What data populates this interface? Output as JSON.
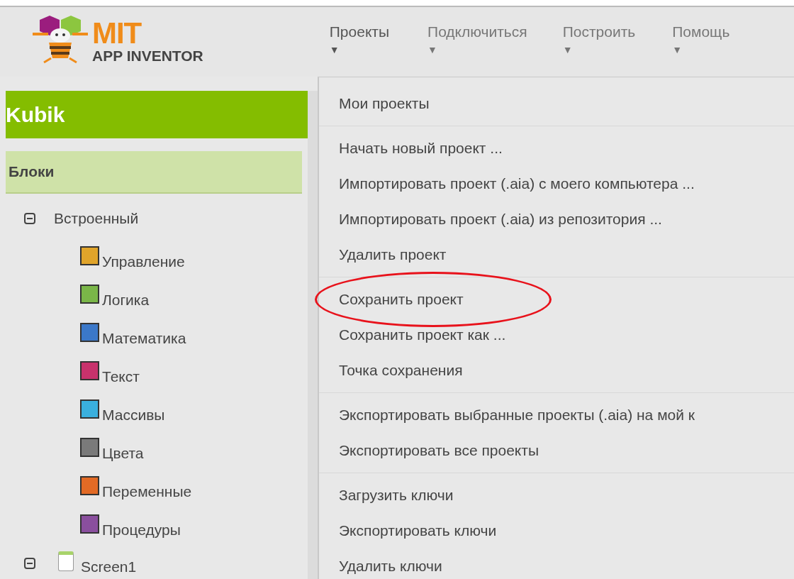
{
  "logo": {
    "title": "MIT",
    "subtitle": "APP INVENTOR"
  },
  "nav": [
    {
      "label": "Проекты",
      "arrow": "▼",
      "selected": true
    },
    {
      "label": "Подключиться",
      "arrow": "▼",
      "selected": false
    },
    {
      "label": "Построить",
      "arrow": "▼",
      "selected": false
    },
    {
      "label": "Помощь",
      "arrow": "▼",
      "selected": false
    }
  ],
  "project": {
    "name": "Kubik"
  },
  "blocks_panel": {
    "title": "Блоки",
    "tree": [
      {
        "label": "Встроенный",
        "kind": "group",
        "expanded": true,
        "children": [
          {
            "label": "Управление",
            "color": "#e0a42a"
          },
          {
            "label": "Логика",
            "color": "#7ab648"
          },
          {
            "label": "Математика",
            "color": "#3b78c9"
          },
          {
            "label": "Текст",
            "color": "#c8326c"
          },
          {
            "label": "Массивы",
            "color": "#3ab0de"
          },
          {
            "label": "Цвета",
            "color": "#7a7a7a"
          },
          {
            "label": "Переменные",
            "color": "#e26a25"
          },
          {
            "label": "Процедуры",
            "color": "#8a4f9e"
          }
        ]
      },
      {
        "label": "Screen1",
        "kind": "screen",
        "expanded": true
      }
    ]
  },
  "menu": {
    "groups": [
      [
        {
          "label": "Мои проекты",
          "circled": false
        }
      ],
      [
        {
          "label": "Начать новый проект ...",
          "circled": false
        },
        {
          "label": "Импортировать проект (.aia) с моего компьютера ...",
          "circled": false
        },
        {
          "label": "Импортировать проект (.aia) из репозитория ...",
          "circled": false
        },
        {
          "label": "Удалить проект",
          "circled": false
        }
      ],
      [
        {
          "label": "Сохранить проект",
          "circled": true
        },
        {
          "label": "Сохранить проект как ...",
          "circled": false
        },
        {
          "label": "Точка сохранения",
          "circled": false
        }
      ],
      [
        {
          "label": "Экспортировать выбранные проекты (.aia) на мой к",
          "circled": false
        },
        {
          "label": "Экспортировать все проекты",
          "circled": false
        }
      ],
      [
        {
          "label": "Загрузить ключи",
          "circled": false
        },
        {
          "label": "Экспортировать ключи",
          "circled": false
        },
        {
          "label": "Удалить ключи",
          "circled": false
        }
      ]
    ]
  }
}
